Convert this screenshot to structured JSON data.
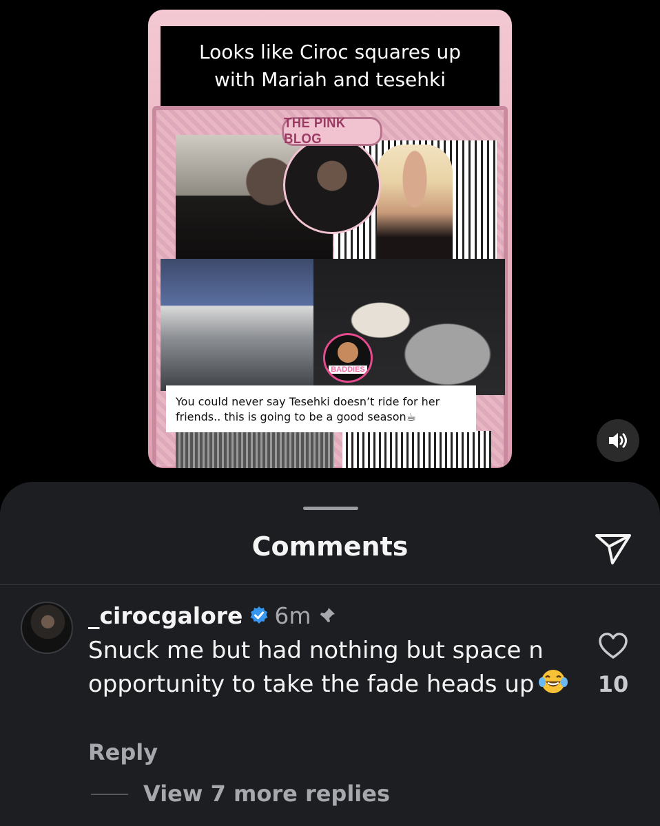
{
  "post": {
    "caption": "Looks like Ciroc squares up\nwith Mariah and tesehki",
    "banner_title": "THE PINK BLOG",
    "logo_text": "BADDIES",
    "overlay_caption": "You could never say Tesehki doesn’t ride for her friends.. this is going to be a good season☕"
  },
  "controls": {
    "sound_icon": "speaker-on-icon"
  },
  "comments_sheet": {
    "title": "Comments",
    "share_icon": "paper-plane-icon",
    "comment": {
      "username": "_cirocgalore",
      "verified": true,
      "time": "6m",
      "pinned": true,
      "text": "Snuck me but had nothing but space n opportunity to take the fade heads up",
      "emoji": "😂",
      "like_count": "10",
      "reply_label": "Reply",
      "view_replies_label": "View 7 more replies"
    }
  },
  "colors": {
    "background": "#000000",
    "sheet": "#1c1e22",
    "verified_blue": "#3897f0",
    "secondary_text": "#a6a8ad"
  }
}
